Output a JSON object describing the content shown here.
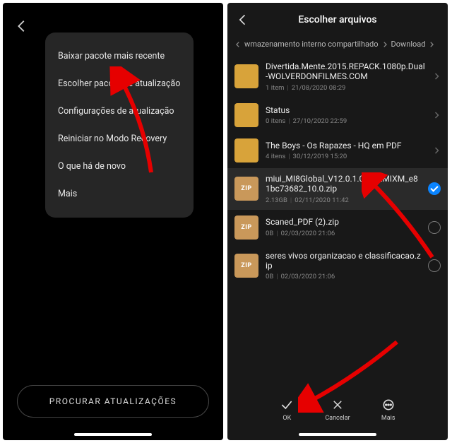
{
  "left": {
    "menu": [
      "Baixar pacote mais recente",
      "Escolher pacote de atualização",
      "Configurações de atualização",
      "Reiniciar no Modo Recovery",
      "O que há de novo",
      "Mais"
    ],
    "button": "PROCURAR ATUALIZAÇÕES"
  },
  "right": {
    "title": "Escolher arquivos",
    "crumbs": [
      "wmazenamento interno compartilhado",
      "Download"
    ],
    "files": [
      {
        "type": "folder",
        "name": "Divertida.Mente.2015.REPACK.1080p.Dual-WOLVERDONFILMES.COM",
        "meta1": "1 item",
        "meta2": "21/08/2020 08:29",
        "sel": "chev"
      },
      {
        "type": "folder",
        "name": "Status",
        "meta1": "0 itens",
        "meta2": "27/10/2020 22:59",
        "sel": "chev"
      },
      {
        "type": "folder",
        "name": "The Boys - Os Rapazes - HQ em PDF",
        "meta1": "4 itens",
        "meta2": "30/12/2019 15:20",
        "sel": "chev"
      },
      {
        "type": "zip",
        "name": "miui_MI8Global_V12.0.1.0.QEAMIXM_e81bc73682_10.0.zip",
        "meta1": "2.13GB",
        "meta2": "02/11/2020 11:42",
        "sel": "checked"
      },
      {
        "type": "zip",
        "name": "Scaned_PDF (2).zip",
        "meta1": "0B",
        "meta2": "02/03/2020 21:06",
        "sel": "radio"
      },
      {
        "type": "zip",
        "name": "seres vivos organizacao e classificacao.zip",
        "meta1": "0B",
        "meta2": "02/03/2020 21:06",
        "sel": "radio"
      }
    ],
    "bottom": {
      "ok": "OK",
      "cancel": "Cancelar",
      "more": "Mais"
    }
  },
  "icons": {
    "zip_label": "ZIP"
  }
}
